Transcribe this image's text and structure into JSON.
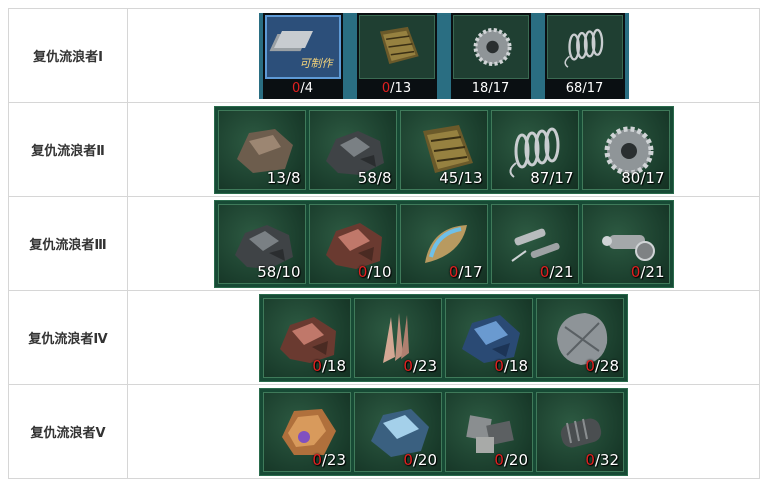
{
  "rows": [
    {
      "label": "复仇流浪者Ⅰ",
      "items": [
        {
          "name": "plate-icon",
          "have": "0",
          "need": "/4",
          "zero": true,
          "tag": "可制作"
        },
        {
          "name": "scale-armor-icon",
          "have": "0",
          "need": "/13",
          "zero": true
        },
        {
          "name": "gear-icon",
          "have": "18",
          "need": "/17",
          "zero": false
        },
        {
          "name": "spring-icon",
          "have": "68",
          "need": "/17",
          "zero": false
        }
      ]
    },
    {
      "label": "复仇流浪者Ⅱ",
      "items": [
        {
          "name": "rock-icon",
          "have": "13",
          "need": "/8",
          "zero": false
        },
        {
          "name": "dark-ore-icon",
          "have": "58",
          "need": "/8",
          "zero": false
        },
        {
          "name": "scale-armor-icon",
          "have": "45",
          "need": "/13",
          "zero": false
        },
        {
          "name": "spring-icon",
          "have": "87",
          "need": "/17",
          "zero": false
        },
        {
          "name": "gear-icon",
          "have": "80",
          "need": "/17",
          "zero": false
        }
      ]
    },
    {
      "label": "复仇流浪者Ⅲ",
      "items": [
        {
          "name": "dark-ore-icon",
          "have": "58",
          "need": "/10",
          "zero": false
        },
        {
          "name": "red-ore-icon",
          "have": "0",
          "need": "/10",
          "zero": true
        },
        {
          "name": "crystal-shard-icon",
          "have": "0",
          "need": "/17",
          "zero": true
        },
        {
          "name": "tube-parts-icon",
          "have": "0",
          "need": "/21",
          "zero": true
        },
        {
          "name": "mechanical-joint-icon",
          "have": "0",
          "need": "/21",
          "zero": true
        }
      ]
    },
    {
      "label": "复仇流浪者Ⅳ",
      "items": [
        {
          "name": "red-ore-icon",
          "have": "0",
          "need": "/18",
          "zero": true
        },
        {
          "name": "claw-icon",
          "have": "0",
          "need": "/23",
          "zero": true
        },
        {
          "name": "blue-crystal-icon",
          "have": "0",
          "need": "/18",
          "zero": true
        },
        {
          "name": "steel-plate-icon",
          "have": "0",
          "need": "/28",
          "zero": true
        }
      ]
    },
    {
      "label": "复仇流浪者Ⅴ",
      "items": [
        {
          "name": "amber-shell-icon",
          "have": "0",
          "need": "/23",
          "zero": true
        },
        {
          "name": "ice-crystal-icon",
          "have": "0",
          "need": "/20",
          "zero": true
        },
        {
          "name": "metal-chunks-icon",
          "have": "0",
          "need": "/20",
          "zero": true
        },
        {
          "name": "engine-core-icon",
          "have": "0",
          "need": "/32",
          "zero": true
        }
      ]
    }
  ]
}
